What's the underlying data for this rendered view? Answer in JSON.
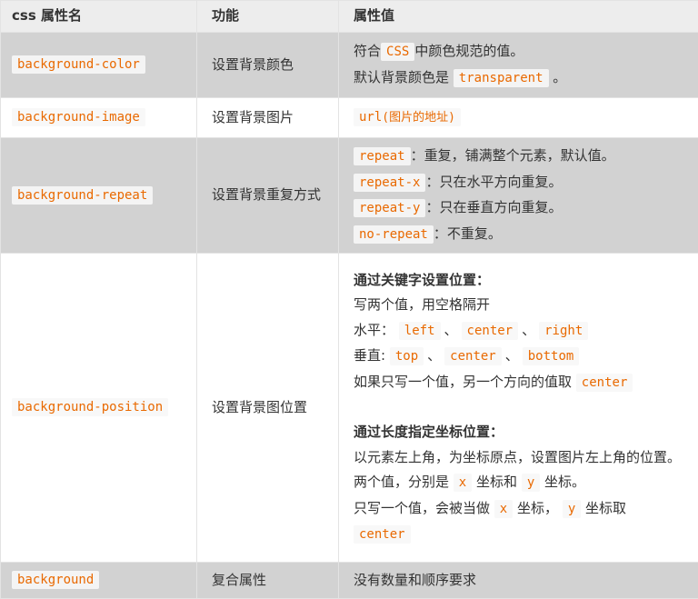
{
  "header": {
    "col_prefix": "css",
    "col_name": "属性名",
    "col_function": "功能",
    "col_value": "属性值"
  },
  "rows": [
    {
      "name": "background-color",
      "function": "设置背景颜色",
      "v1_pre": "符合",
      "v1_code": "CSS",
      "v1_post": "中颜色规范的值。",
      "v2_pre": "默认背景颜色是",
      "v2_code": "transparent",
      "v2_post": "。"
    },
    {
      "name": "background-image",
      "function": "设置背景图片",
      "v_code": "url",
      "v_paren": "(图片的地址)"
    },
    {
      "name": "background-repeat",
      "function": "设置背景重复方式",
      "items": [
        {
          "code": "repeat",
          "text": "：重复，铺满整个元素，默认值。"
        },
        {
          "code": "repeat-x",
          "text": "：只在水平方向重复。"
        },
        {
          "code": "repeat-y",
          "text": "：只在垂直方向重复。"
        },
        {
          "code": "no-repeat",
          "text": "：不重复。"
        }
      ]
    },
    {
      "name": "background-position",
      "function": "设置背景图位置",
      "kw_title": "通过关键字设置位置：",
      "kw_line1": "写两个值，用空格隔开",
      "kw_h_label": "水平：",
      "kw_h_left": "left",
      "kw_h_center": "center",
      "kw_h_right": "right",
      "kw_v_label": "垂直:",
      "kw_v_top": "top",
      "kw_v_center": "center",
      "kw_v_bottom": "bottom",
      "sep": "、",
      "kw_last_pre": "如果只写一个值，另一个方向的值取",
      "kw_last_code": "center",
      "len_title": "通过长度指定坐标位置：",
      "len_line1": "以元素左上角，为坐标原点，设置图片左上角的位置。",
      "len_line2_a": "两个值，分别是",
      "len_line2_x": "x",
      "len_line2_b": "坐标和",
      "len_line2_y": "y",
      "len_line2_c": "坐标。",
      "len_line3_a": "只写一个值，会被当做",
      "len_line3_x": "x",
      "len_line3_b": "坐标，",
      "len_line3_y": "y",
      "len_line3_c": "坐标取",
      "len_line3_code": "center"
    },
    {
      "name": "background",
      "function": "复合属性",
      "value": "没有数量和顺序要求"
    }
  ]
}
